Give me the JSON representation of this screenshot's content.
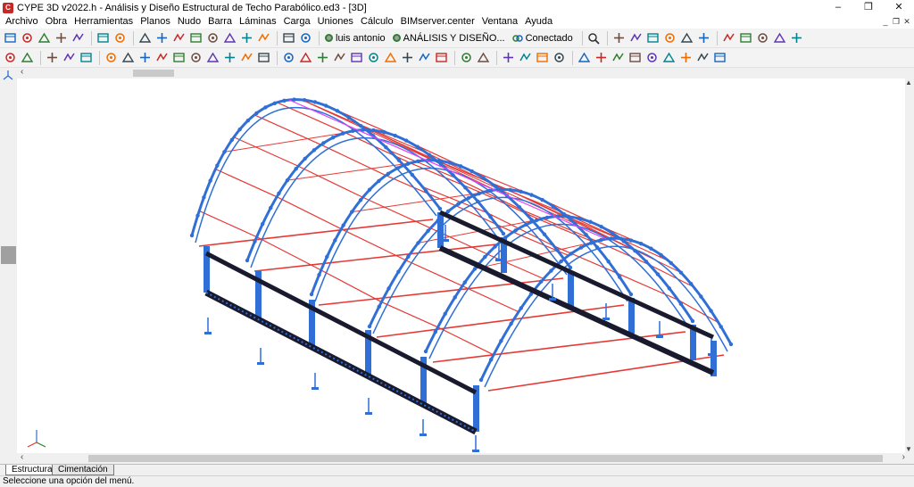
{
  "window": {
    "title": "CYPE 3D v2022.h - Análisis y Diseño Estructural de Techo Parabólico.ed3 - [3D]",
    "minimize": "–",
    "restore": "❐",
    "close": "✕"
  },
  "menu": [
    "Archivo",
    "Obra",
    "Herramientas",
    "Planos",
    "Nudo",
    "Barra",
    "Láminas",
    "Carga",
    "Uniones",
    "Cálculo",
    "BIMserver.center",
    "Ventana",
    "Ayuda"
  ],
  "mdi_controls": [
    "_",
    "❐",
    "✕"
  ],
  "toolbar_text": {
    "user": "luis antonio",
    "project": "ANÁLISIS Y DISEÑO...",
    "connection": "Conectado"
  },
  "tabs": [
    {
      "label": "Estructura",
      "active": true
    },
    {
      "label": "Cimentación",
      "active": false
    }
  ],
  "status": "Seleccione una opción del menú.",
  "colors": {
    "member_blue": "#2f6fd6",
    "member_red": "#e53935",
    "member_dark": "#1a1a2e",
    "accent_pink": "#e040fb"
  },
  "icons_toolbar1": [
    "open-folder-icon",
    "save-icon",
    "print-icon",
    "grid-icon",
    "magnet-icon",
    "undo-icon",
    "redo-icon",
    "zoom-window-icon",
    "zoom-all-icon",
    "zoom-in-icon",
    "zoom-out-icon",
    "rotate-icon",
    "zoom-previous-icon",
    "pan-icon",
    "window-icon",
    "view-3d-icon",
    "axes-icon"
  ],
  "icons_toolbar2": [
    "layers-icon",
    "settings-icon",
    "node-new-icon",
    "node-edit-icon",
    "node-delete-icon",
    "move-icon",
    "copy-icon",
    "mirror-icon",
    "rotate-element-icon",
    "split-icon",
    "join-icon",
    "group-icon",
    "array-icon",
    "select-icon",
    "filter-icon",
    "bar-new-icon",
    "bar-delete-icon",
    "bar-describe-icon",
    "bar-buckling-icon",
    "bar-deflection-icon",
    "bar-release-icon",
    "bar-offset-icon",
    "bar-rotate-icon",
    "bar-copy-icon",
    "bar-symmetry-icon",
    "panel-icon",
    "panel-edit-icon",
    "load-node-icon",
    "load-bar-icon",
    "load-panel-icon",
    "load-delete-icon",
    "calc-icon",
    "check-icon",
    "results-icon",
    "forces-icon",
    "stress-icon",
    "displacement-icon",
    "reactions-icon",
    "envelope-icon",
    "list-icon"
  ]
}
